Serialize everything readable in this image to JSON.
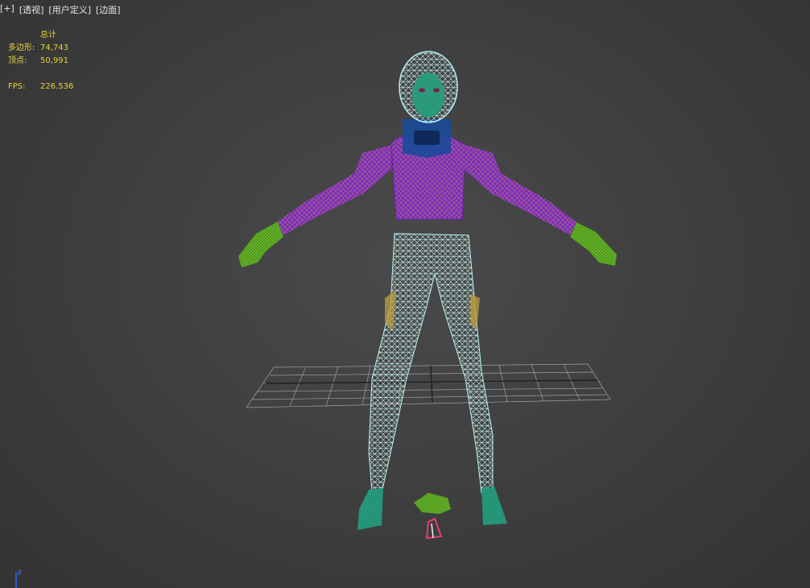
{
  "viewport": {
    "plus_label": "[+]",
    "view_label": "[透视]",
    "mode_label": "[用户定义]",
    "shading_label": "[边面]"
  },
  "stats": {
    "header": "总计",
    "polys_label": "多边形:",
    "polys_value": "74,743",
    "verts_label": "顶点:",
    "verts_value": "50,991",
    "fps_label": "FPS:",
    "fps_value": "226.536"
  },
  "axis": {
    "z_label": "z"
  },
  "colors": {
    "stats_text": "#e8d33a",
    "body_wire": "#b8f0f0",
    "top_purple": "#7a2fc4",
    "mesh_orange": "#d08a2a",
    "skin_green": "#2a9a7a",
    "hand_green": "#5aa020",
    "collar_blue": "#1a4a9a",
    "grid": "#a0a0a0"
  }
}
